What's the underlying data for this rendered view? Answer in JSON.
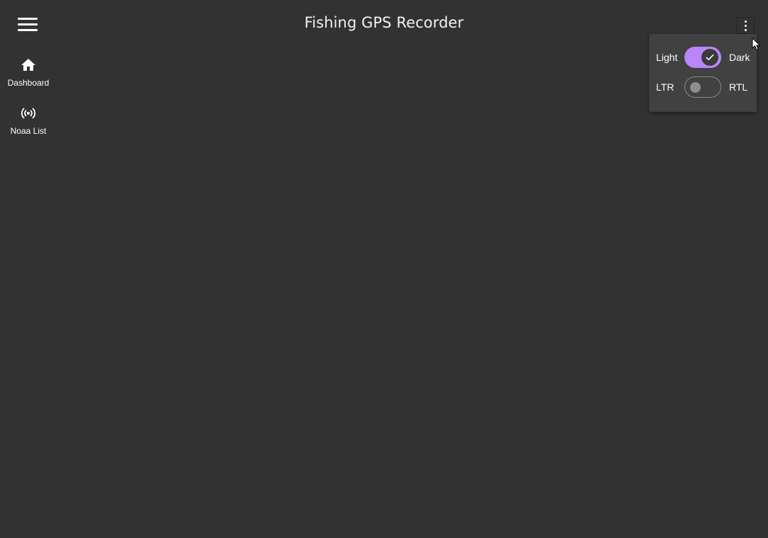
{
  "app": {
    "title": "Fishing GPS Recorder"
  },
  "toolbar": {
    "menu_icon": "hamburger-menu-icon",
    "more_icon": "more-vert-icon"
  },
  "nav": {
    "items": [
      {
        "label": "Dashboard",
        "icon": "home-icon"
      },
      {
        "label": "Noaa List",
        "icon": "radio-signal-icon"
      }
    ]
  },
  "settings_menu": {
    "theme": {
      "left_label": "Light",
      "right_label": "Dark",
      "checked": true
    },
    "direction": {
      "left_label": "LTR",
      "right_label": "RTL",
      "checked": false
    }
  },
  "colors": {
    "background": "#323232",
    "menu_background": "#414141",
    "accent": "#bb86fc"
  }
}
